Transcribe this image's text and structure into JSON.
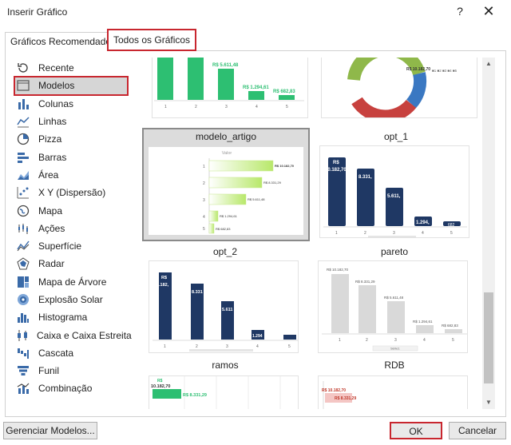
{
  "window": {
    "title": "Inserir Gráfico",
    "help": "?",
    "close": "✕"
  },
  "tabs": [
    {
      "label": "Gráficos Recomendados"
    },
    {
      "label": "Todos os Gráficos"
    }
  ],
  "sidebar": {
    "items": [
      {
        "label": "Recente",
        "icon": "recent-icon"
      },
      {
        "label": "Modelos",
        "icon": "folder-icon"
      },
      {
        "label": "Colunas",
        "icon": "column-chart-icon"
      },
      {
        "label": "Linhas",
        "icon": "line-chart-icon"
      },
      {
        "label": "Pizza",
        "icon": "pie-chart-icon"
      },
      {
        "label": "Barras",
        "icon": "bar-chart-icon"
      },
      {
        "label": "Área",
        "icon": "area-chart-icon"
      },
      {
        "label": "X Y (Dispersão)",
        "icon": "scatter-chart-icon"
      },
      {
        "label": "Mapa",
        "icon": "map-chart-icon"
      },
      {
        "label": "Ações",
        "icon": "stock-chart-icon"
      },
      {
        "label": "Superfície",
        "icon": "surface-chart-icon"
      },
      {
        "label": "Radar",
        "icon": "radar-chart-icon"
      },
      {
        "label": "Mapa de Árvore",
        "icon": "treemap-icon"
      },
      {
        "label": "Explosão Solar",
        "icon": "sunburst-icon"
      },
      {
        "label": "Histograma",
        "icon": "histogram-icon"
      },
      {
        "label": "Caixa e Caixa Estreita",
        "icon": "box-whisker-icon"
      },
      {
        "label": "Cascata",
        "icon": "waterfall-icon"
      },
      {
        "label": "Funil",
        "icon": "funnel-icon"
      },
      {
        "label": "Combinação",
        "icon": "combo-chart-icon"
      }
    ],
    "selected": "Modelos"
  },
  "gallery": {
    "templates": [
      {
        "name": "modelo_artigo"
      },
      {
        "name": "opt_1"
      },
      {
        "name": "opt_2"
      },
      {
        "name": "pareto"
      },
      {
        "name": "ramos"
      },
      {
        "name": "RDB"
      }
    ],
    "selected": "modelo_artigo"
  },
  "thumb_text": {
    "v5611": "R$ 5.611,48",
    "v1294": "R$ 1.294,61",
    "v682": "R$ 682,83",
    "donut_val": "R$ 10.182,70",
    "donut_legend": "■1 ■2 ■3 ■4 ■5",
    "valor": "Valor",
    "b1": "R$ 10.182,70",
    "b2": "R$ 8.331,29",
    "b3": "R$ 5.611,48",
    "b4": "R$ 1.294,61",
    "b5": "R$ 682,83",
    "opt_rs": "R$",
    "opt_b1": "10.182,70",
    "opt_b2": "8.331,",
    "opt_b3": "5.611,",
    "opt_b4": "1.294,",
    "opt_b5": "682",
    "opt2_b1": ".182,",
    "opt2_b2": "8.331",
    "opt2_b3": "5.611",
    "opt2_b4": "1.294",
    "pareto_b1": "R$ 10.182,70",
    "pareto_b2": "R$ 8.331,29",
    "pareto_b3": "R$ 5.611,48",
    "pareto_b4": "R$ 1.294,61",
    "pareto_b5": "R$ 682,83",
    "serie": "Série1",
    "ramos_rs": "R$",
    "ramos_b1": "10.182,70",
    "ramos_b2": "R$ 8.331,29",
    "rdb_b1": "R$ 10.182,70",
    "rdb_b2": "R$ 8.331,29",
    "x1": "1",
    "x2": "2",
    "x3": "3",
    "x4": "4",
    "x5": "5"
  },
  "colors": {
    "accent_red": "#c8272f",
    "green": "#2dbf72",
    "navy": "#1f3864",
    "gray_bar": "#d9d9d9"
  },
  "buttons": {
    "manage": "Gerenciar Modelos...",
    "ok": "OK",
    "cancel": "Cancelar"
  }
}
